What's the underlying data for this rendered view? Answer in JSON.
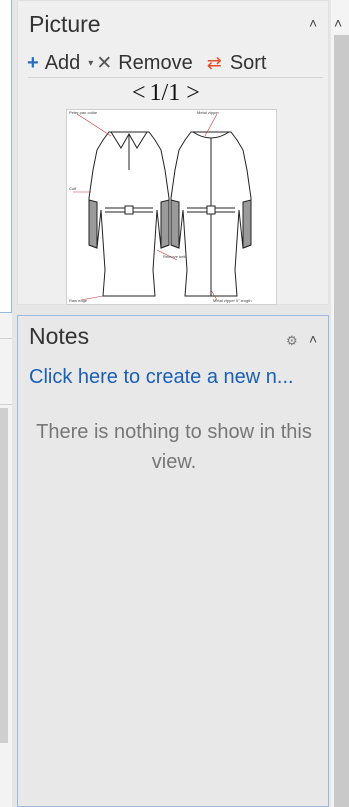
{
  "picture_panel": {
    "title": "Picture",
    "toolbar": {
      "add_label": "Add",
      "remove_label": "Remove",
      "sort_label": "Sort",
      "add_icon": "+",
      "dropdown_icon": "▾",
      "remove_icon": "✕",
      "sort_icon": "⇄"
    },
    "pager": {
      "prev": "<",
      "text": "1/1",
      "next": ">"
    },
    "image": {
      "description_icon": "dress-technical-sketch",
      "sketch_labels": [
        "Peter pan collar",
        "Metal zipper",
        "Cuff",
        "Remove belt",
        "Raw edge",
        "Metal zipper 5\" length"
      ]
    }
  },
  "notes_panel": {
    "title": "Notes",
    "create_link": "Click here to create a new n...",
    "empty_message": "There is nothing to show in this view."
  },
  "colors": {
    "accent_blue": "#1a5fb4",
    "sort_icon_color": "#e04e2a",
    "border_blue": "#9bb9dd"
  }
}
